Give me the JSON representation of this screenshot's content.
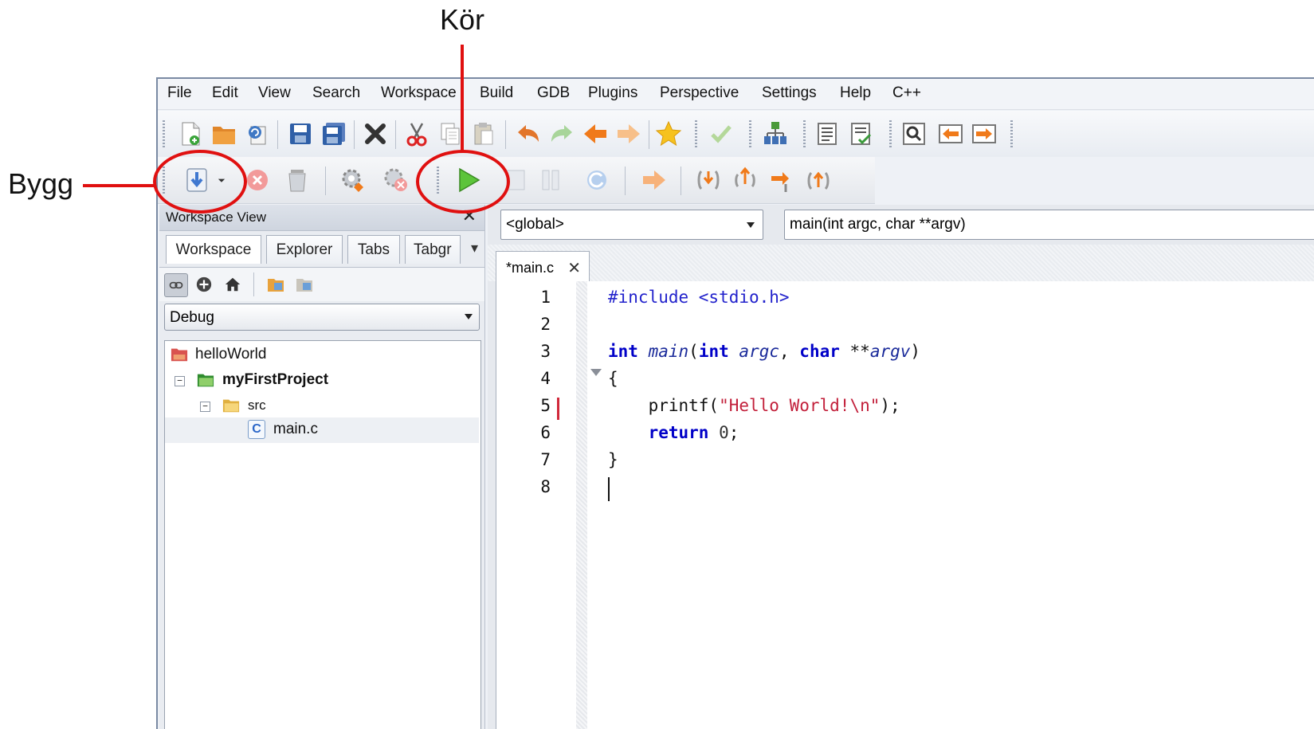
{
  "annotations": {
    "build_label": "Bygg",
    "run_label": "Kör",
    "color": "#e01010"
  },
  "menubar": {
    "items": [
      "File",
      "Edit",
      "View",
      "Search",
      "Workspace",
      "Build",
      "GDB",
      "Plugins",
      "Perspective",
      "Settings",
      "Help",
      "C++"
    ]
  },
  "toolbar": {
    "icons": [
      "new-file-icon",
      "open-folder-icon",
      "reload-icon",
      "save-icon",
      "save-all-icon",
      "close-icon",
      "cut-icon",
      "copy-icon",
      "paste-icon",
      "undo-icon",
      "redo-icon",
      "back-icon",
      "forward-icon",
      "bookmark-star-icon",
      "check-icon",
      "class-diagram-icon",
      "outline-icon",
      "tasks-icon",
      "find-icon",
      "prev-match-icon",
      "next-match-icon"
    ],
    "build_icons": [
      "build-icon",
      "dropdown-arrow-icon",
      "stop-build-icon",
      "clean-icon",
      "settings-gear-icon",
      "stop-gear-icon",
      "run-icon",
      "stop-debug-icon",
      "pause-icon",
      "restart-icon",
      "continue-icon",
      "step-in-icon",
      "step-out-icon",
      "step-over-icon",
      "show-cursor-icon"
    ]
  },
  "workspace_view": {
    "title": "Workspace View",
    "close_glyph": "✕",
    "tabs": [
      "Workspace",
      "Explorer",
      "Tabs",
      "Tabgr"
    ],
    "more_glyph": "▾",
    "configuration": "Debug",
    "tree": {
      "workspace": "helloWorld",
      "project": "myFirstProject",
      "folder": "src",
      "file": "main.c",
      "file_badge": "C",
      "collapse_glyph": "−"
    }
  },
  "editor": {
    "scope_combo": "<global>",
    "function_combo": "main(int argc, char **argv)",
    "tab_label": "*main.c",
    "tab_close_glyph": "✕",
    "line_numbers": [
      "1",
      "2",
      "3",
      "4",
      "5",
      "6",
      "7",
      "8"
    ],
    "code": {
      "l1_pp": "#include <stdio.h>",
      "l3_kw1": "int",
      "l3_fn": "main",
      "l3_p1": "(",
      "l3_kw2": "int",
      "l3_arg1": "argc",
      "l3_comma": ", ",
      "l3_kw3": "char",
      "l3_star": " **",
      "l3_arg2": "argv",
      "l3_close": ")",
      "l4": "{",
      "l5_fn": "    printf(",
      "l5_str": "\"Hello World!\\n\"",
      "l5_end": ");",
      "l6_kw": "    return",
      "l6_num": " 0",
      "l6_end": ";",
      "l7": "}"
    }
  }
}
